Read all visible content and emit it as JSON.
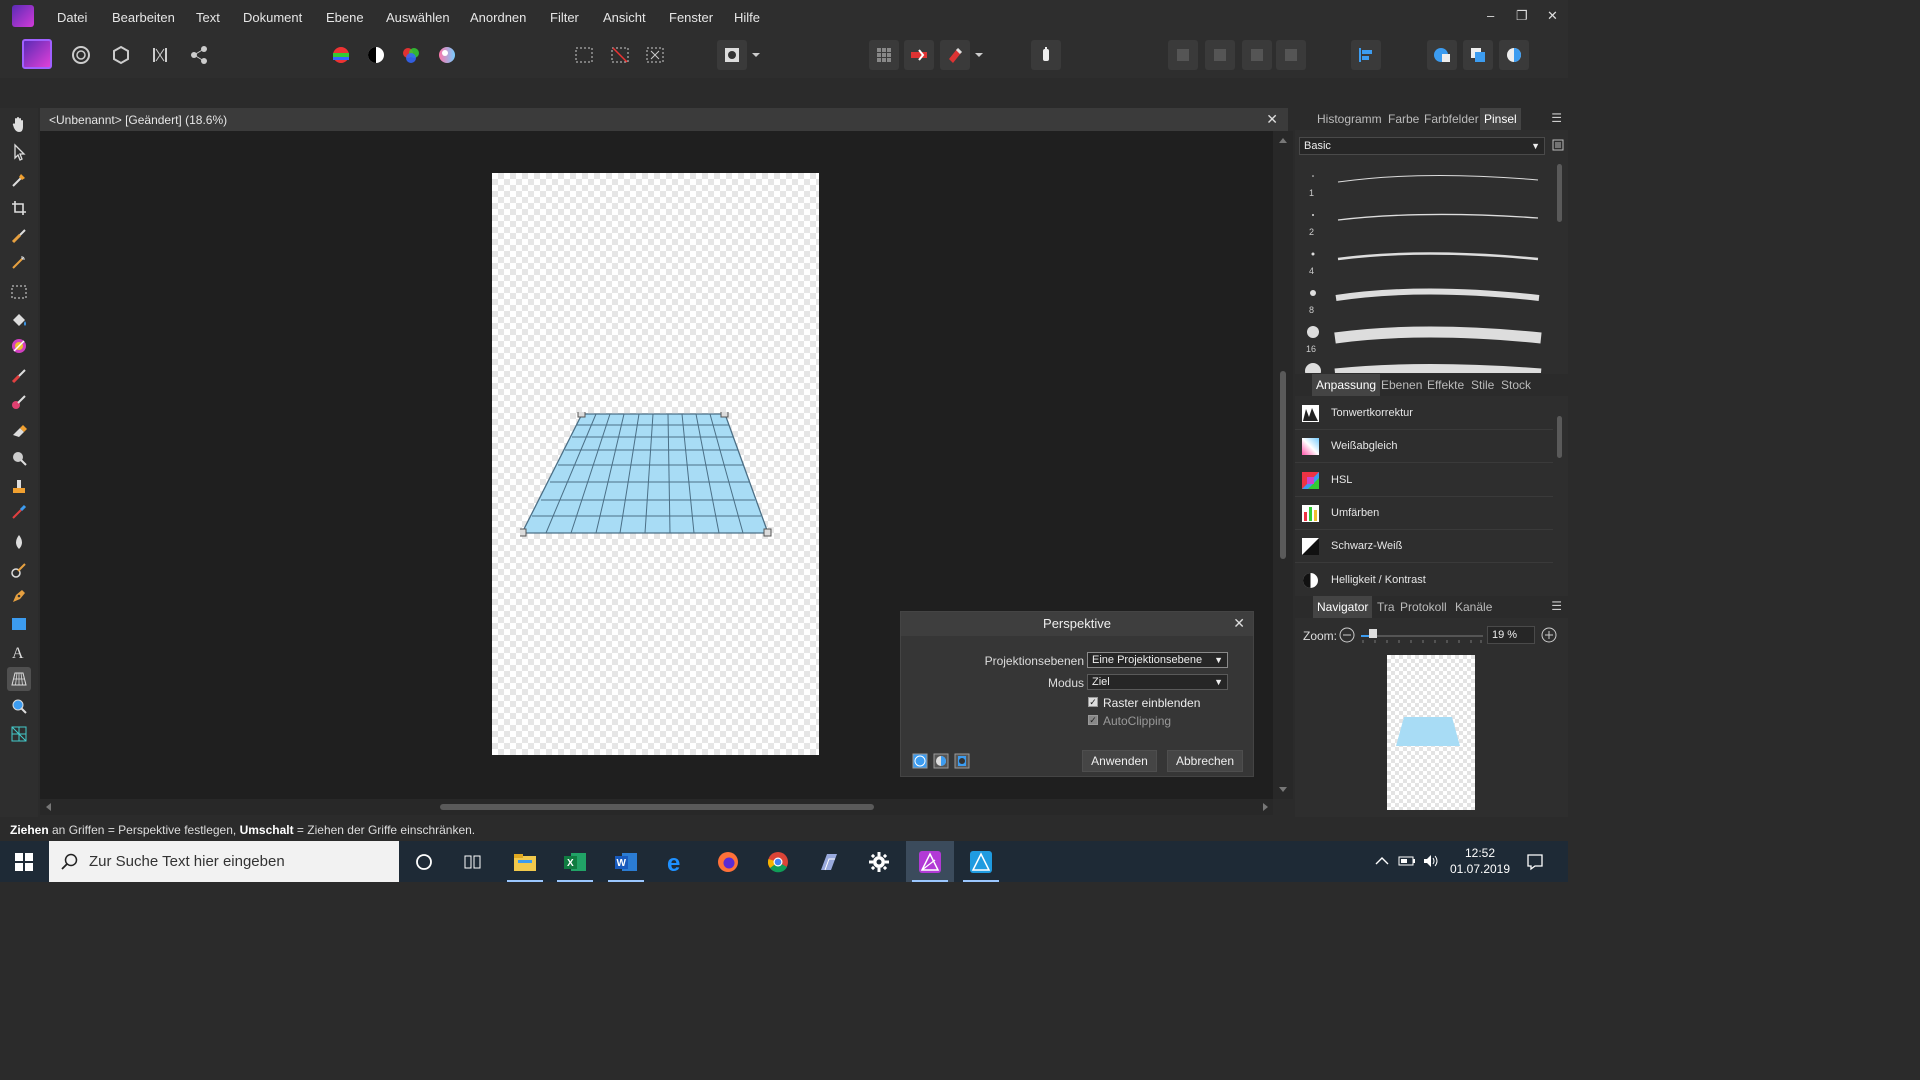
{
  "menubar": {
    "items": [
      "Datei",
      "Bearbeiten",
      "Text",
      "Dokument",
      "Ebene",
      "Auswählen",
      "Anordnen",
      "Filter",
      "Ansicht",
      "Fenster",
      "Hilfe"
    ],
    "window_controls": [
      "–",
      "❐",
      "✕"
    ]
  },
  "document": {
    "tab_title": "<Unbenannt> [Geändert] (18.6%)",
    "close_glyph": "✕"
  },
  "dialog": {
    "title": "Perspektive",
    "close_glyph": "✕",
    "projection_label": "Projektionsebenen",
    "projection_value": "Eine Projektionsebene",
    "mode_label": "Modus",
    "mode_value": "Ziel",
    "show_grid_label": "Raster einblenden",
    "show_grid_checked": true,
    "autoclip_label": "AutoClipping",
    "autoclip_checked": true,
    "apply_label": "Anwenden",
    "cancel_label": "Abbrechen"
  },
  "brush_panel": {
    "tabs": [
      "Histogramm",
      "Farbe",
      "Farbfelder",
      "Pinsel"
    ],
    "active_tab": "Pinsel",
    "category": "Basic",
    "sizes": [
      "1",
      "2",
      "4",
      "8",
      "16"
    ]
  },
  "adjust_panel": {
    "tabs": [
      "Anpassung",
      "Ebenen",
      "Effekte",
      "Stile",
      "Stock"
    ],
    "active_tab": "Anpassung",
    "items": [
      "Tonwertkorrektur",
      "Weißabgleich",
      "HSL",
      "Umfärben",
      "Schwarz-Weiß",
      "Helligkeit / Kontrast"
    ]
  },
  "navigator_panel": {
    "tabs": [
      "Navigator",
      "Tra",
      "Protokoll",
      "Kanäle"
    ],
    "active_tab": "Navigator",
    "zoom_label": "Zoom:",
    "zoom_value": "19 %"
  },
  "statusbar": {
    "part1_bold": "Ziehen",
    "part2": " an Griffen = Perspektive festlegen, ",
    "part3_bold": "Umschalt",
    "part4": " = Ziehen der Griffe einschränken."
  },
  "taskbar": {
    "search_placeholder": "Zur Suche Text hier eingeben",
    "time": "12:52",
    "date": "01.07.2019"
  },
  "colors": {
    "accent_arrow": "#f2e600",
    "grid_fill": "#a8dcf5",
    "grid_stroke": "#4b6f86",
    "persona_accent": "#b23ad6"
  }
}
